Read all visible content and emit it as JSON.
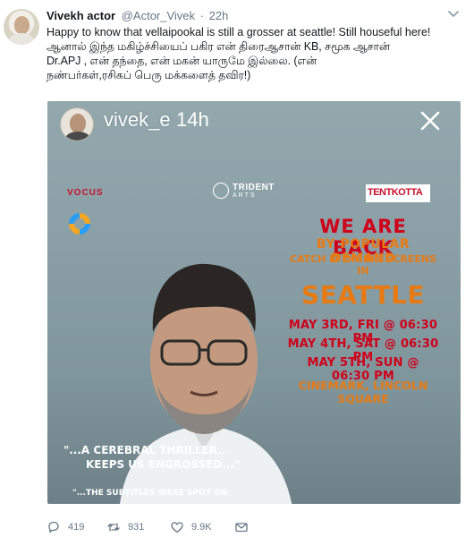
{
  "tweet": {
    "display_name": "Vivekh actor",
    "handle": "@Actor_Vivek",
    "separator": "·",
    "time": "22h",
    "text_english": "Happy to know that vellaipookal is still a grosser at seattle! Still houseful here!",
    "text_tamil_line1": "ஆனால் இந்த மகிழ்ச்சியைப் பகிர என் திரைஆசான் KB, சமூக ஆசான்",
    "text_tamil_line2": "Dr.APJ , என் தந்தை, என் மகன் யாருமே இல்லை. (என்",
    "text_tamil_line3": "நண்பர்கள்,ரசிகப் பெரு மக்களைத் தவிர!)"
  },
  "story": {
    "username": "vivek_e",
    "time": "14h"
  },
  "poster": {
    "logo_vocus": "VOCUS",
    "logo_trident_name": "TRIDENT",
    "logo_trident_sub": "ARTS",
    "logo_tentkotta": "TENTKOTTA",
    "headline": "WE ARE BACK",
    "sub1": "BY POPULAR DEMAND",
    "sub2": "CATCH IT ON BIG SCREENS IN",
    "city": "SEATTLE",
    "shows": [
      "MAY 3RD, FRI @ 06:30 PM",
      "MAY 4TH, SAT @ 06:30 PM",
      "MAY 5TH, SUN @ 06:30 PM"
    ],
    "venue": "CINEMARK, LINCOLN SQUARE",
    "quote1": "\"...A CEREBRAL THRILLER..",
    "quote2": "KEEPS US ENGROSSED...\"",
    "quote3": "\"...THE SUBTITLES WERE SPOT ON"
  },
  "actions": {
    "reply_count": "419",
    "retweet_count": "931",
    "like_count": "9.9K"
  },
  "colors": {
    "poster_red": "#d0001b",
    "poster_orange": "#e87a14",
    "muted": "#657786",
    "text": "#14171a"
  }
}
